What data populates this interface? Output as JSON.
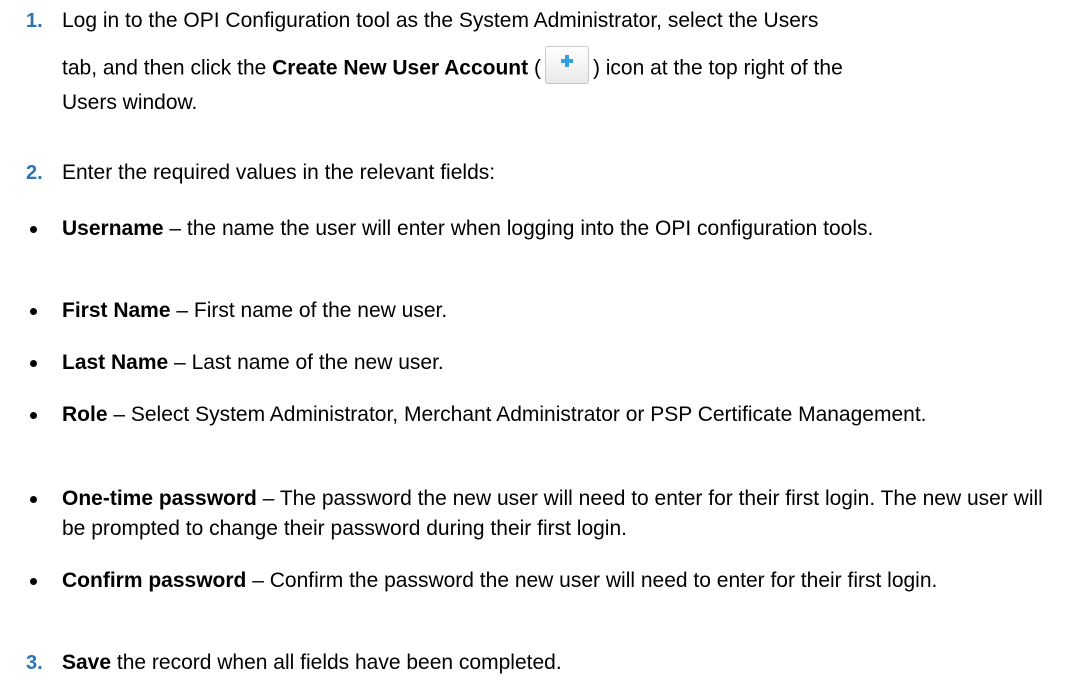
{
  "steps": [
    {
      "number": "1.",
      "t1": "Log in to the OPI Configuration tool as the System Administrator, select the Users",
      "t2": "tab, and then click the ",
      "bold": "Create New User Account",
      "t3": " (",
      "icon": "plus-icon",
      "t4": ") icon at the top right of the",
      "t5": "Users window."
    },
    {
      "number": "2.",
      "text": "Enter the required values in the relevant fields:"
    },
    {
      "number": "3.",
      "bold": "Save",
      "text": " the record when all fields have been completed."
    }
  ],
  "fields": [
    {
      "name": "Username",
      "dash": " – ",
      "desc": "the name the user will enter when logging into the OPI configuration tools."
    },
    {
      "name": "First Name",
      "dash": " – ",
      "desc": "First name of the new user."
    },
    {
      "name": "Last Name",
      "dash": " – ",
      "desc": "Last name of the new user."
    },
    {
      "name": "Role",
      "dash": " – ",
      "desc": "Select System Administrator, Merchant Administrator or PSP Certificate Management."
    },
    {
      "name": "One-time password",
      "dash": " – ",
      "desc": "The password the new user will need to enter for their first login. The new user will be prompted to change their password during their first login."
    },
    {
      "name": "Confirm password",
      "dash": " – ",
      "desc": "Confirm the password the new user will need to enter for their first login."
    }
  ],
  "colors": {
    "step_number": "#2e74b5",
    "icon_plus": "#33a0e0"
  }
}
